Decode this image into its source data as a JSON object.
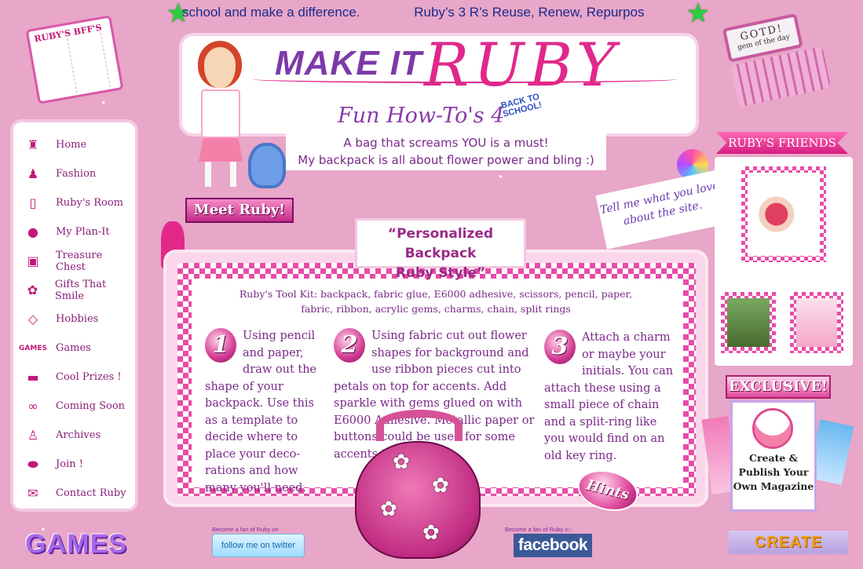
{
  "ticker": {
    "messages": [
      "school and make a difference.",
      "Ruby’s 3 R’s Reuse, Renew, Repurpos"
    ]
  },
  "bff_book": {
    "title": "RUBY'S BFF'S"
  },
  "gotd": {
    "title": "GOTD!",
    "subtitle": "gem of the day"
  },
  "header": {
    "logo_make": "MAKE IT",
    "logo_ruby": "RUBY",
    "tagline": "Fun How-To's 4",
    "back_to_school": "BACK TO SCHOOL!",
    "blurb_line1": "A bag that screams YOU is a must!",
    "blurb_line2": "My backpack is all about flower power and bling :)"
  },
  "meet_ruby": "Meet Ruby!",
  "nav": {
    "items": [
      {
        "label": "Home",
        "icon": "lantern-icon"
      },
      {
        "label": "Fashion",
        "icon": "dress-form-icon"
      },
      {
        "label": "Ruby's Room",
        "icon": "door-icon"
      },
      {
        "label": "My Plan-It",
        "icon": "planet-icon"
      },
      {
        "label": "Treasure Chest",
        "icon": "treasure-chest-icon"
      },
      {
        "label": "Gifts That Smile",
        "icon": "gift-icon"
      },
      {
        "label": "Hobbies",
        "icon": "kite-icon"
      },
      {
        "label": "Games",
        "icon": "games-icon"
      },
      {
        "label": "Cool Prizes !",
        "icon": "prize-icon"
      },
      {
        "label": "Coming Soon",
        "icon": "glasses-icon"
      },
      {
        "label": "Archives",
        "icon": "archive-icon"
      },
      {
        "label": "Join !",
        "icon": "join-icon"
      },
      {
        "label": "Contact Ruby",
        "icon": "envelope-icon"
      }
    ]
  },
  "main": {
    "title_line1": "“Personalized Backpack",
    "title_line2": "Ruby Style”",
    "toolkit_line1": "Ruby's Tool Kit: backpack, fabric glue, E6000 adhesive, scissors, pencil, paper,",
    "toolkit_line2": "fabric, ribbon, acrylic gems, charms, chain, split rings",
    "steps": [
      {
        "number": "1",
        "text": "Using pencil and paper, draw out the shape of your backpack. Use this as a template to decide where to place your deco-rations and how many you'll need."
      },
      {
        "number": "2",
        "text": "Using fabric cut out flower shapes for background and use ribbon pieces cut into petals on top for accents. Add sparkle with gems glued on with E6000 Adhesive. Metallic paper or buttons could be used for some accents that pop!"
      },
      {
        "number": "3",
        "text": "Attach a charm or maybe your initials. You can attach these using a small piece of chain and a split-ring like you would find on an old key ring."
      }
    ],
    "hints": "Hints"
  },
  "right": {
    "tell_me": "Tell me what you love about the site.",
    "friends_title": "RUBY'S FRIENDS",
    "exclusive": "EXCLUSIVE!",
    "magazine": "Create & Publish Your Own Magazine"
  },
  "footer": {
    "games": "GAMES",
    "twitter_caption": "Become a fan of Ruby on",
    "twitter_label": "follow me on twitter",
    "facebook_caption": "Become a fan of Ruby on",
    "facebook_label": "facebook",
    "create": "CREATE"
  },
  "colors": {
    "background": "#e8a6c8",
    "brand_pink": "#e0288a",
    "brand_purple": "#7c3aa8",
    "facebook_blue": "#3b5998"
  }
}
